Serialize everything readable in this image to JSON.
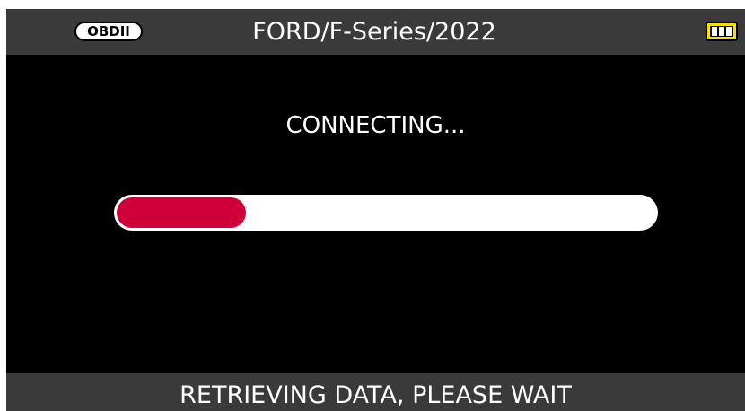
{
  "header": {
    "badge": "OBDII",
    "title": "FORD/F-Series/2022",
    "battery_icon": "battery-full-icon",
    "battery_color": "#f5e200"
  },
  "main": {
    "status": "CONNECTING...",
    "progress": {
      "fraction": 0.24,
      "fill_color": "#cf0039",
      "track_color": "#ffffff"
    }
  },
  "footer": {
    "message": "RETRIEVING DATA, PLEASE WAIT"
  }
}
